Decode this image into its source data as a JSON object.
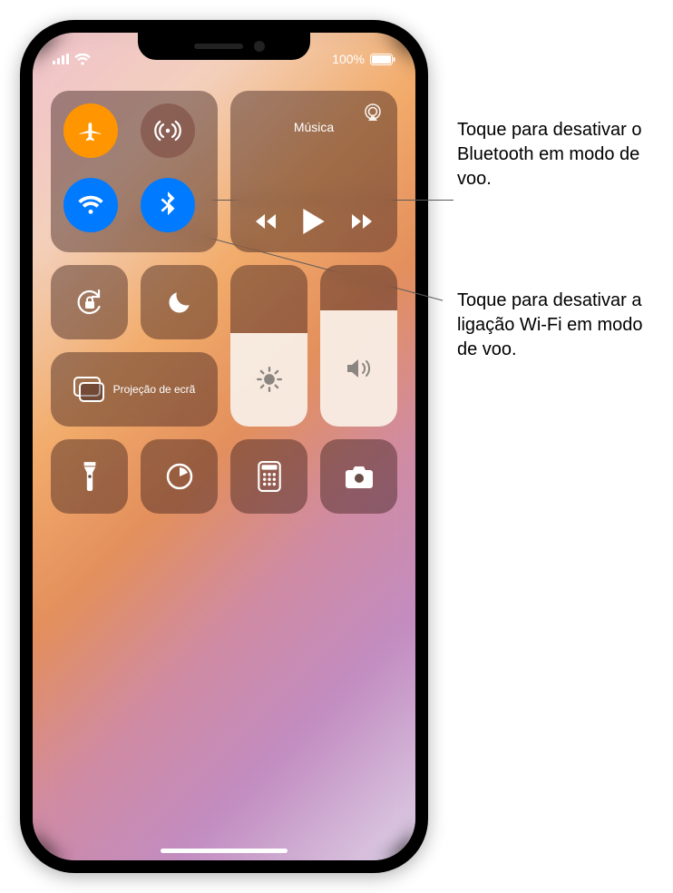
{
  "status": {
    "battery_text": "100%"
  },
  "music": {
    "title": "Música"
  },
  "mirror": {
    "label": "Projeção de ecrã"
  },
  "sliders": {
    "brightness_pct": 58,
    "volume_pct": 72
  },
  "callouts": {
    "bluetooth": "Toque para desativar o Bluetooth em modo de voo.",
    "wifi": "Toque para desativar a ligação Wi-Fi em modo de voo."
  },
  "icons": {
    "airplane": "airplane-icon",
    "cellular": "cellular-antenna-icon",
    "wifi": "wifi-icon",
    "bluetooth": "bluetooth-icon",
    "airplay": "airplay-icon",
    "prev": "skip-back-icon",
    "play": "play-icon",
    "next": "skip-forward-icon",
    "orientation_lock": "orientation-lock-icon",
    "dnd": "do-not-disturb-icon",
    "mirror": "screen-mirroring-icon",
    "brightness": "brightness-icon",
    "volume": "volume-icon",
    "flashlight": "flashlight-icon",
    "timer": "timer-icon",
    "calculator": "calculator-icon",
    "camera": "camera-icon"
  }
}
